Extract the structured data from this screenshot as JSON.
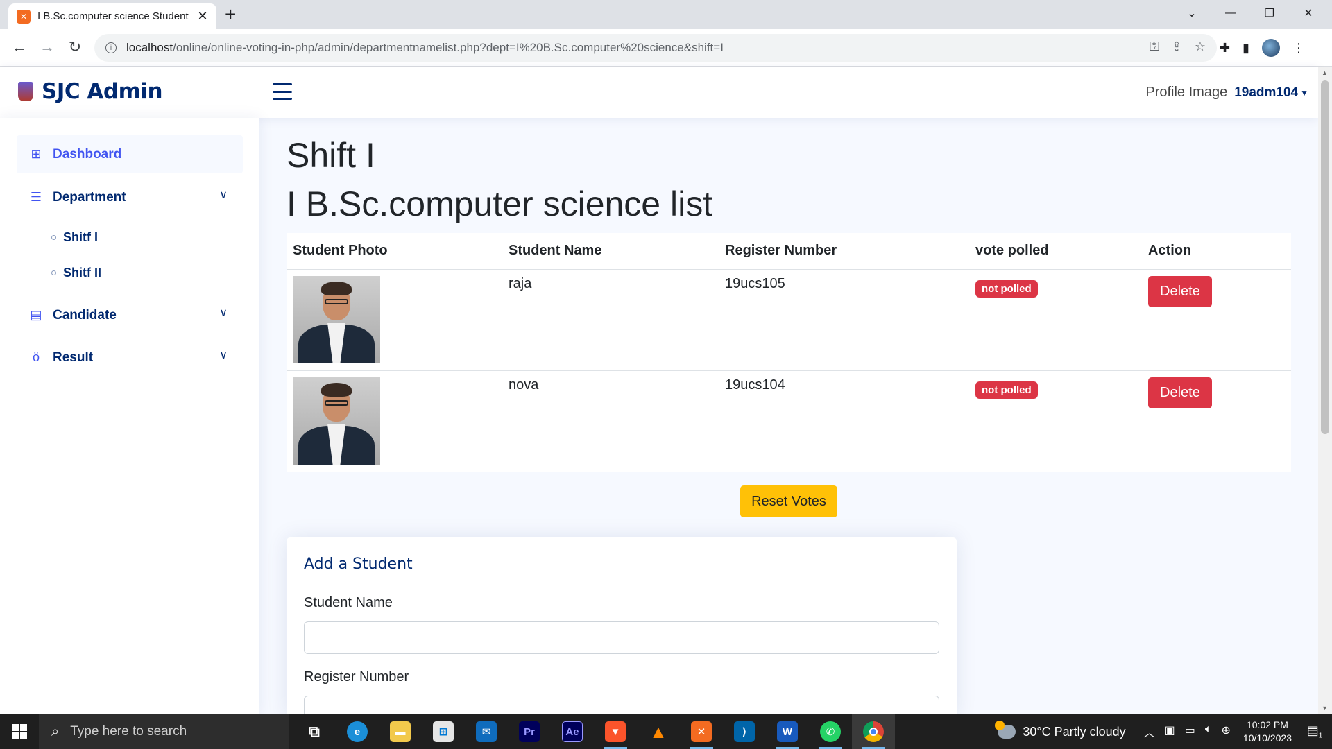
{
  "browser": {
    "tab_title": "I B.Sc.computer science Student",
    "tab_favicon": "xampp-icon",
    "new_tab": "+",
    "url_host": "localhost",
    "url_path": "/online/online-voting-in-php/admin/departmentnamelist.php?dept=I%20B.Sc.computer%20science&shift=I"
  },
  "header": {
    "brand": "SJC Admin",
    "profile_image_alt": "Profile Image",
    "username": "19adm104"
  },
  "sidebar": {
    "dashboard": "Dashboard",
    "department": "Department",
    "shift1": "Shitf I",
    "shift2": "Shitf II",
    "candidate": "Candidate",
    "result": "Result"
  },
  "main": {
    "shift_heading": "Shift I",
    "list_heading": "I B.Sc.computer science list",
    "columns": [
      "Student Photo",
      "Student Name",
      "Register Number",
      "vote polled",
      "Action"
    ],
    "rows": [
      {
        "name": "raja",
        "register": "19ucs105",
        "status": "not polled",
        "action": "Delete"
      },
      {
        "name": "nova",
        "register": "19ucs104",
        "status": "not polled",
        "action": "Delete"
      }
    ],
    "reset_label": "Reset Votes"
  },
  "form": {
    "title": "Add a Student",
    "name_label": "Student Name",
    "register_label": "Register Number"
  },
  "taskbar": {
    "search_placeholder": "Type here to search",
    "weather": "30°C  Partly cloudy",
    "time": "10:02 PM",
    "date": "10/10/2023",
    "notifications": "1"
  },
  "colors": {
    "brand": "#012970",
    "accent": "#4154f1",
    "danger": "#dc3545",
    "warning": "#ffc107"
  }
}
